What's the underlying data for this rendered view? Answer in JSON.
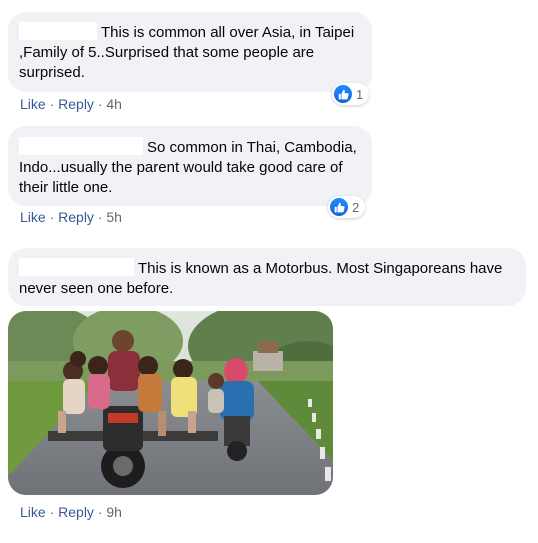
{
  "colors": {
    "bubble_bg": "#f0f2f5",
    "link": "#385898",
    "meta": "#65676b",
    "like_blue": "#1877f2"
  },
  "comments": [
    {
      "text": "This is common all over Asia, in Taipei ,Family of 5..Surprised that some people are surprised.",
      "actions": {
        "like": "Like",
        "reply": "Reply",
        "time": "4h"
      },
      "reaction": {
        "icon": "like-icon",
        "count": "1"
      }
    },
    {
      "text": "So common in Thai, Cambodia, Indo...usually the parent would take good care of their little one.",
      "actions": {
        "like": "Like",
        "reply": "Reply",
        "time": "5h"
      },
      "reaction": {
        "icon": "like-icon",
        "count": "2"
      }
    },
    {
      "text": "This is known as a Motorbus. Most Singaporeans have never seen one before.",
      "actions": {
        "like": "Like",
        "reply": "Reply",
        "time": "9h"
      },
      "attachment": {
        "icon": "photo-family-on-motorbike"
      }
    }
  ]
}
